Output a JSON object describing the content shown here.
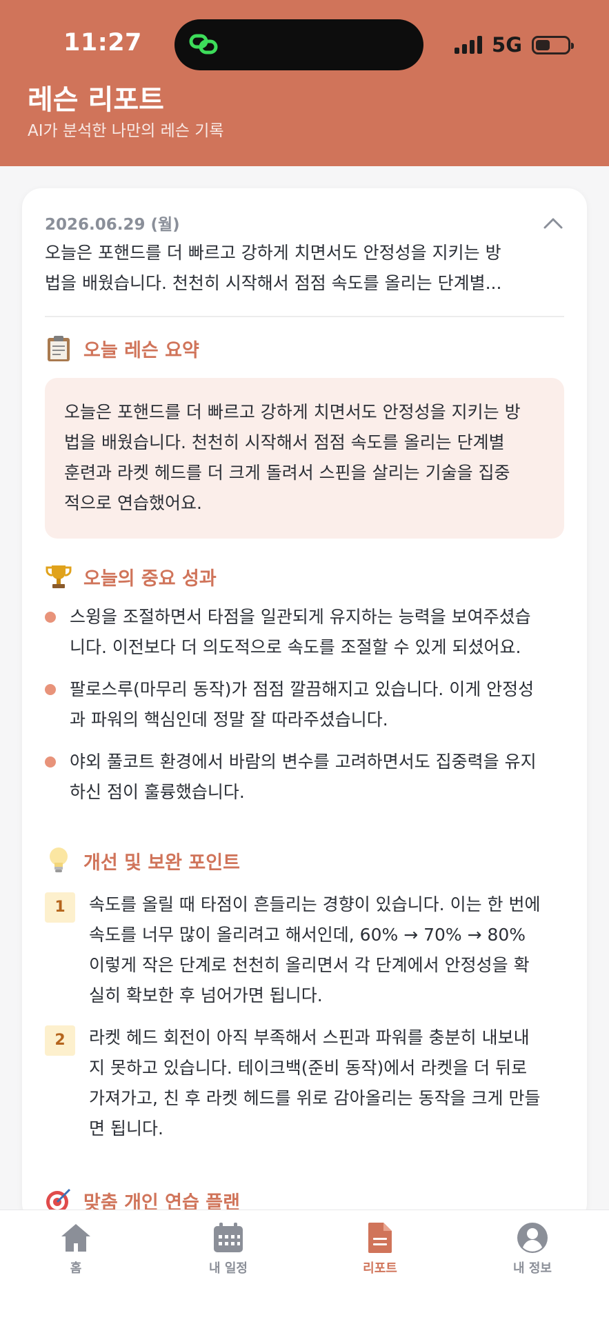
{
  "status_bar": {
    "time": "11:27",
    "network": "5G"
  },
  "header": {
    "title": "레슨 리포트",
    "subtitle": "AI가 분석한 나만의 레슨 기록"
  },
  "report": {
    "date": "2026.06.29 (월)",
    "preview_line1": "오늘은 포핸드를 더 빠르고 강하게 치면서도 안정성을 지키는 방",
    "preview_line2": "법을 배웠습니다. 천천히 시작해서 점점 속도를 올리는 단계별...",
    "summary": {
      "title": "오늘 레슨 요약",
      "icon": "clipboard-icon",
      "lines": [
        "오늘은 포핸드를 더 빠르고 강하게 치면서도 안정성을 지키는 방",
        "법을 배웠습니다. 천천히 시작해서 점점 속도를 올리는 단계별",
        "훈련과 라켓 헤드를 더 크게 돌려서 스핀을 살리는 기술을 집중",
        "적으로 연습했어요."
      ]
    },
    "achievements": {
      "title": "오늘의 중요 성과",
      "icon": "trophy-icon",
      "items": [
        {
          "line1": "스윙을 조절하면서 타점을 일관되게 유지하는 능력을 보여주셨습",
          "line2": "니다. 이전보다 더 의도적으로 속도를 조절할 수 있게 되셨어요."
        },
        {
          "line1": "팔로스루(마무리 동작)가 점점 깔끔해지고 있습니다. 이게 안정성",
          "line2": "과 파워의 핵심인데 정말 잘 따라주셨습니다."
        },
        {
          "line1": "야외 풀코트 환경에서 바람의 변수를 고려하면서도 집중력을 유지",
          "line2": "하신 점이 훌륭했습니다."
        }
      ]
    },
    "improvements": {
      "title": "개선 및 보완 포인트",
      "icon": "lightbulb-icon",
      "items": [
        {
          "num": "1",
          "lines": [
            "속도를 올릴 때 타점이 흔들리는 경향이 있습니다. 이는 한 번에",
            "속도를 너무 많이 올리려고 해서인데, 60% → 70% → 80%",
            "이렇게 작은 단계로 천천히 올리면서 각 단계에서 안정성을 확",
            "실히 확보한 후 넘어가면 됩니다."
          ]
        },
        {
          "num": "2",
          "lines": [
            "라켓 헤드 회전이 아직 부족해서 스핀과 파워를 충분히 내보내",
            "지 못하고 있습니다. 테이크백(준비 동작)에서 라켓을 더 뒤로",
            "가져가고, 친 후 라켓 헤드를 위로 감아올리는 동작을 크게 만들",
            "면 됩니다."
          ]
        }
      ]
    },
    "practice_plan": {
      "title": "맞춤 개인 연습 플랜",
      "icon": "target-icon"
    }
  },
  "bottom_nav": {
    "items": [
      {
        "label": "홈",
        "icon": "home-icon"
      },
      {
        "label": "내 일정",
        "icon": "calendar-icon"
      },
      {
        "label": "리포트",
        "icon": "document-icon",
        "active": true
      },
      {
        "label": "내 정보",
        "icon": "profile-icon"
      }
    ]
  },
  "colors": {
    "accent": "#d0745a",
    "summary_bg": "#fbeeea",
    "number_badge_bg": "#fdf0cd",
    "bullet": "#e8937a"
  }
}
